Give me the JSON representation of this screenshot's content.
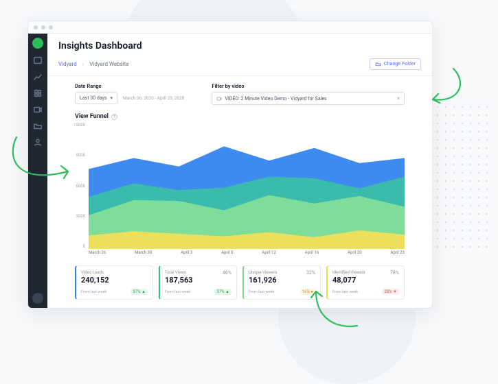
{
  "header": {
    "title": "Insights Dashboard"
  },
  "breadcrumbs": {
    "root": "Vidyard",
    "sep": "›",
    "current": "Vidyard Website"
  },
  "change_folder": {
    "label": "Change Folder"
  },
  "controls": {
    "date_range": {
      "label": "Date Range",
      "value": "Last 30 days",
      "caption": "March 26, 2020 - April 23, 2020"
    },
    "filter": {
      "label": "Filter by video",
      "value": "VIDEO: 2 Minute Video Demo - Vidyard for Sales"
    }
  },
  "chart": {
    "title": "View Funnel"
  },
  "chart_data": {
    "type": "area",
    "title": "View Funnel",
    "xlabel": "",
    "ylabel": "",
    "ylim": [
      0,
      15000
    ],
    "yticks": [
      15000,
      9000,
      6000,
      3000,
      0
    ],
    "categories": [
      "March 26",
      "March 30",
      "April 3",
      "April 8",
      "April 12",
      "April 16",
      "April 20",
      "April 23"
    ],
    "series": [
      {
        "name": "Video Loads",
        "color": "#2f80ed",
        "values": [
          9500,
          10800,
          9800,
          12200,
          10500,
          12000,
          10200,
          10800
        ]
      },
      {
        "name": "Total Views",
        "color": "#3abfa5",
        "values": [
          6200,
          7800,
          7000,
          7300,
          8600,
          8400,
          7200,
          8600
        ]
      },
      {
        "name": "Unique Viewers",
        "color": "#86e09a",
        "values": [
          4000,
          5800,
          5700,
          4600,
          6400,
          5400,
          6300,
          5000
        ]
      },
      {
        "name": "Identified Viewers",
        "color": "#f4df55",
        "values": [
          1600,
          2100,
          1800,
          1500,
          2000,
          1400,
          2200,
          1700
        ]
      }
    ]
  },
  "cards": [
    {
      "label": "Video Loads",
      "value": "240,152",
      "pct": "",
      "sub": "From last week",
      "delta": "37%",
      "dir": "up"
    },
    {
      "label": "Total Views",
      "value": "187,563",
      "pct": "46%",
      "sub": "From last week",
      "delta": "37%",
      "dir": "up"
    },
    {
      "label": "Unique Viewers",
      "value": "161,926",
      "pct": "32%",
      "sub": "From last week",
      "delta": "16%",
      "dir": "flat"
    },
    {
      "label": "Identified Viewers",
      "value": "48,077",
      "pct": "78%",
      "sub": "From last week",
      "delta": "28%",
      "dir": "down"
    }
  ]
}
